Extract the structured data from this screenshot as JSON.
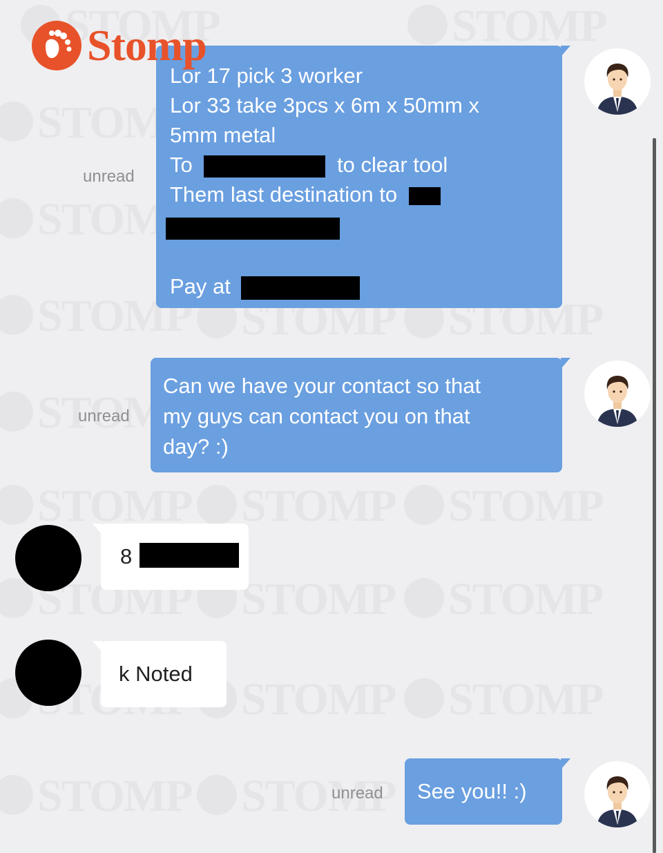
{
  "brand": {
    "name": "Stomp",
    "color": "#e8522a",
    "icon": "footprint-icon"
  },
  "watermark_text": "STOMP",
  "colors": {
    "outgoing_bubble": "#6a9fe0",
    "incoming_bubble": "#ffffff",
    "background": "#efeff1"
  },
  "messages": [
    {
      "from": "me",
      "status": "unread",
      "lines": [
        "Lor 17 pick 3 worker",
        "Lor 33 take 3pcs x 6m x 50mm x",
        "5mm metal",
        "To",
        "to clear tool",
        "Them last destination to",
        "Pay at"
      ]
    },
    {
      "from": "me",
      "status": "unread",
      "lines": [
        "Can we have your contact so that",
        "my guys can contact you on that",
        "day? :)"
      ]
    },
    {
      "from": "them",
      "lines": [
        "8"
      ]
    },
    {
      "from": "them",
      "lines": [
        "k Noted"
      ]
    },
    {
      "from": "me",
      "status": "unread",
      "lines": [
        "See you!! :)"
      ]
    }
  ]
}
